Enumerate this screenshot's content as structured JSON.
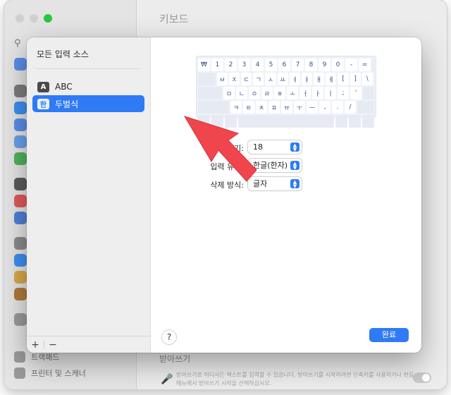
{
  "background": {
    "window_title": "키보드",
    "footer_items": [
      "트랙패드",
      "프린터 및 스캐너"
    ],
    "section_title": "받아쓰기",
    "section_desc": "받아쓰기로 어디서든 텍스트를 입력할 수 있습니다. 받아쓰기를 시작하려면 단축키를 사용하거나 편집 메뉴에서 받아쓰기 시작을 선택하십시오."
  },
  "sheet": {
    "sidebar_title": "모든 입력 소스",
    "sources": [
      {
        "badge": "A",
        "label": "ABC"
      },
      {
        "badge": "한",
        "label": "두벌식"
      }
    ],
    "add_label": "+",
    "remove_label": "−",
    "keyboard_rows": [
      [
        "₩",
        "1",
        "2",
        "3",
        "4",
        "5",
        "6",
        "7",
        "8",
        "9",
        "0",
        "-",
        "="
      ],
      [
        "ㅂ",
        "ㅈ",
        "ㄷ",
        "ㄱ",
        "ㅅ",
        "ㅛ",
        "ㅕ",
        "ㅑ",
        "ㅐ",
        "ㅔ",
        "[",
        "]",
        "\\"
      ],
      [
        "ㅁ",
        "ㄴ",
        "ㅇ",
        "ㄹ",
        "ㅎ",
        "ㅗ",
        "ㅓ",
        "ㅏ",
        "ㅣ",
        ";",
        "'"
      ],
      [
        "ㅋ",
        "ㅌ",
        "ㅊ",
        "ㅍ",
        "ㅠ",
        "ㅜ",
        "ㅡ",
        ",",
        ".",
        "/"
      ]
    ],
    "form": {
      "font_size_label": "서체 크기:",
      "font_size_value": "18",
      "input_type_label": "입력 유형:",
      "input_type_value": "한글(한자)",
      "delete_mode_label": "삭제 방식:",
      "delete_mode_value": "글자"
    },
    "help_label": "?",
    "done_label": "완료"
  },
  "colors": {
    "accent": "#2f7bf6",
    "annotation_arrow": "#f0454d"
  },
  "icons": [
    "search-icon",
    "keyboard-icon",
    "microphone-icon",
    "chevron-up-down-icon",
    "annotation-arrow-icon"
  ]
}
